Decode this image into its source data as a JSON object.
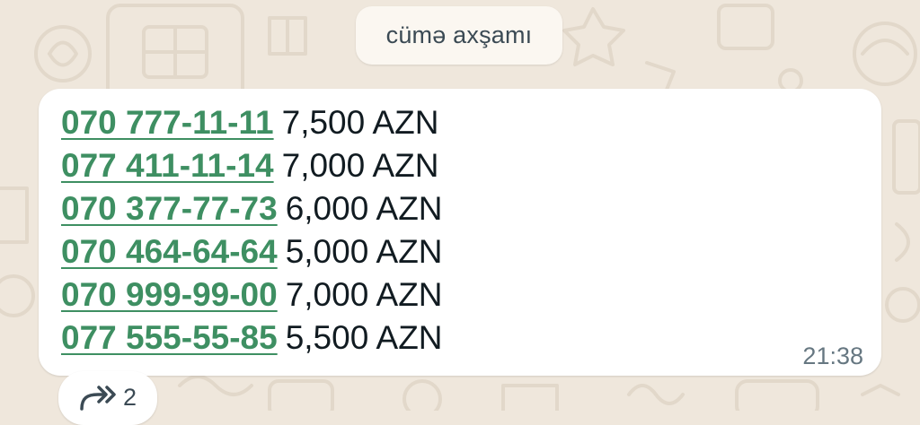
{
  "date_separator": "cümə axşamı",
  "message": {
    "rows": [
      {
        "phone": "070 777-11-11",
        "price": "7,500 AZN"
      },
      {
        "phone": "077 411-11-14",
        "price": "7,000 AZN"
      },
      {
        "phone": "070 377-77-73",
        "price": "6,000 AZN"
      },
      {
        "phone": "070 464-64-64",
        "price": "5,000 AZN"
      },
      {
        "phone": "070 999-99-00",
        "price": "7,000 AZN"
      },
      {
        "phone": "077 555-55-85",
        "price": "5,500 AZN"
      }
    ],
    "time": "21:38"
  },
  "forwarded": {
    "icon": "forward-icon",
    "count": "2"
  },
  "colors": {
    "wallpaper": "#efe7dc",
    "bubble": "#ffffff",
    "link": "#3e8f62",
    "text": "#111b21",
    "meta": "#667781"
  }
}
